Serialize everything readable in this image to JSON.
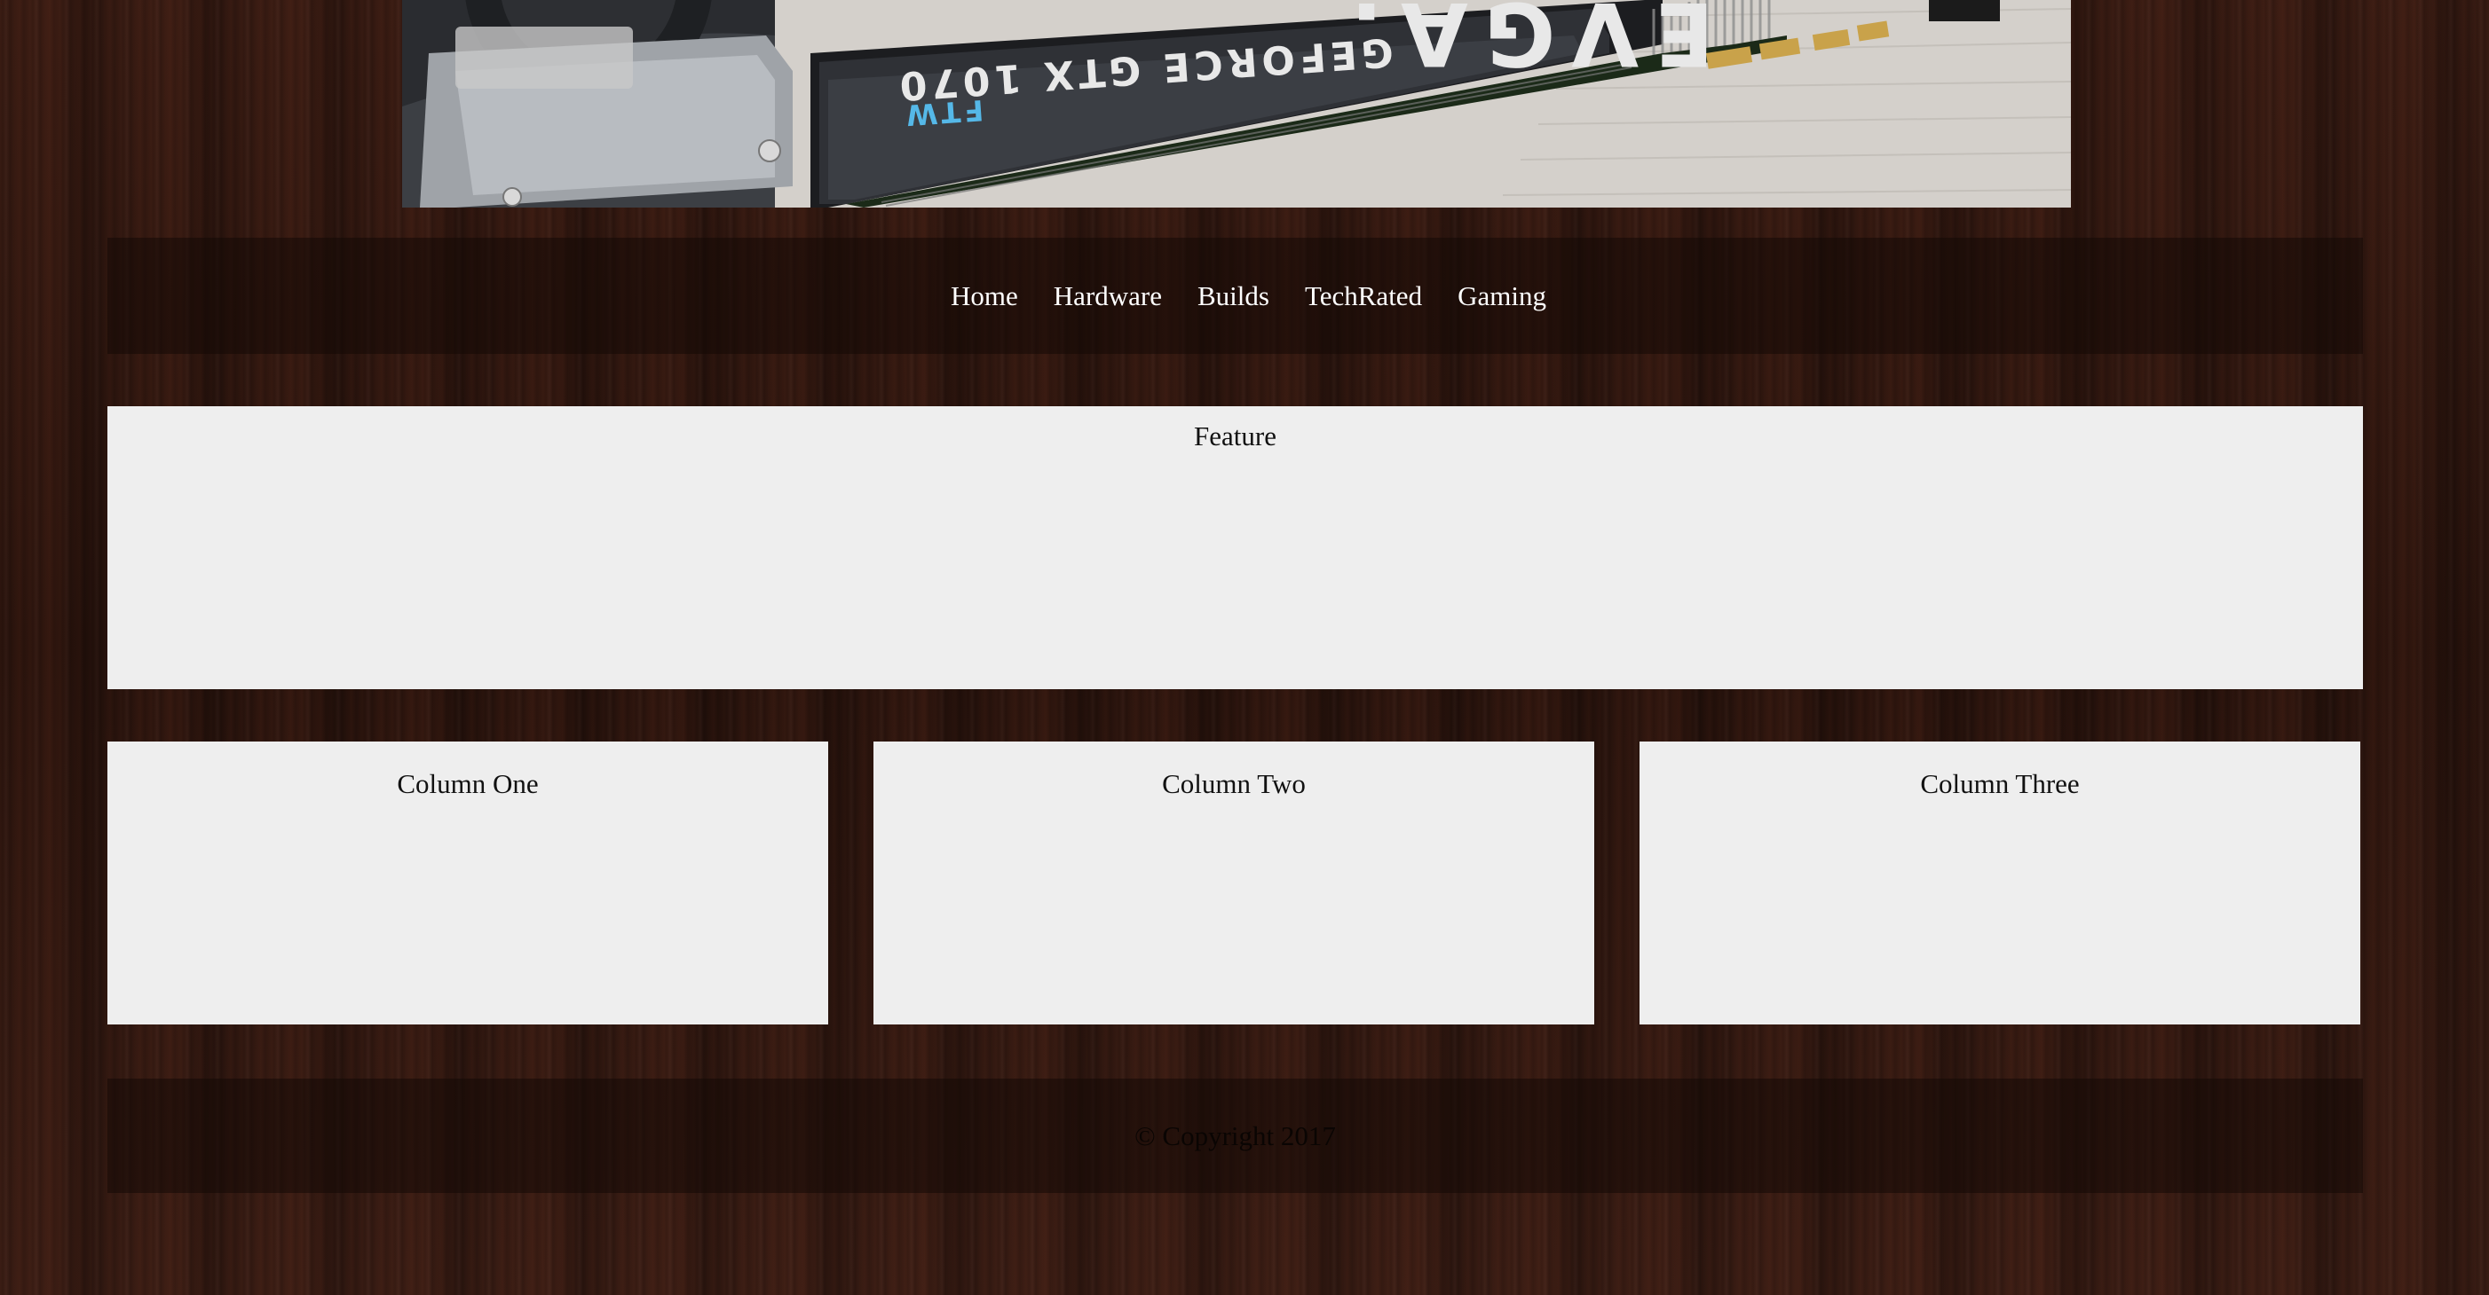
{
  "banner": {
    "icon": "graphics-card-photo",
    "brand_text": "EVGA.",
    "model_text": "GEFORCE GTX 1070",
    "sub_text": "FTW"
  },
  "nav": {
    "items": [
      {
        "label": "Home"
      },
      {
        "label": "Hardware"
      },
      {
        "label": "Builds"
      },
      {
        "label": "TechRated"
      },
      {
        "label": "Gaming"
      }
    ]
  },
  "feature": {
    "title": "Feature"
  },
  "columns": [
    {
      "title": "Column One"
    },
    {
      "title": "Column Two"
    },
    {
      "title": "Column Three"
    }
  ],
  "footer": {
    "copyright": "© Copyright 2017"
  },
  "colors": {
    "panel_bg": "#eeeeee",
    "nav_text": "#ffffff",
    "page_bg": "#2a140e",
    "accent_blue": "#55b8e8"
  }
}
